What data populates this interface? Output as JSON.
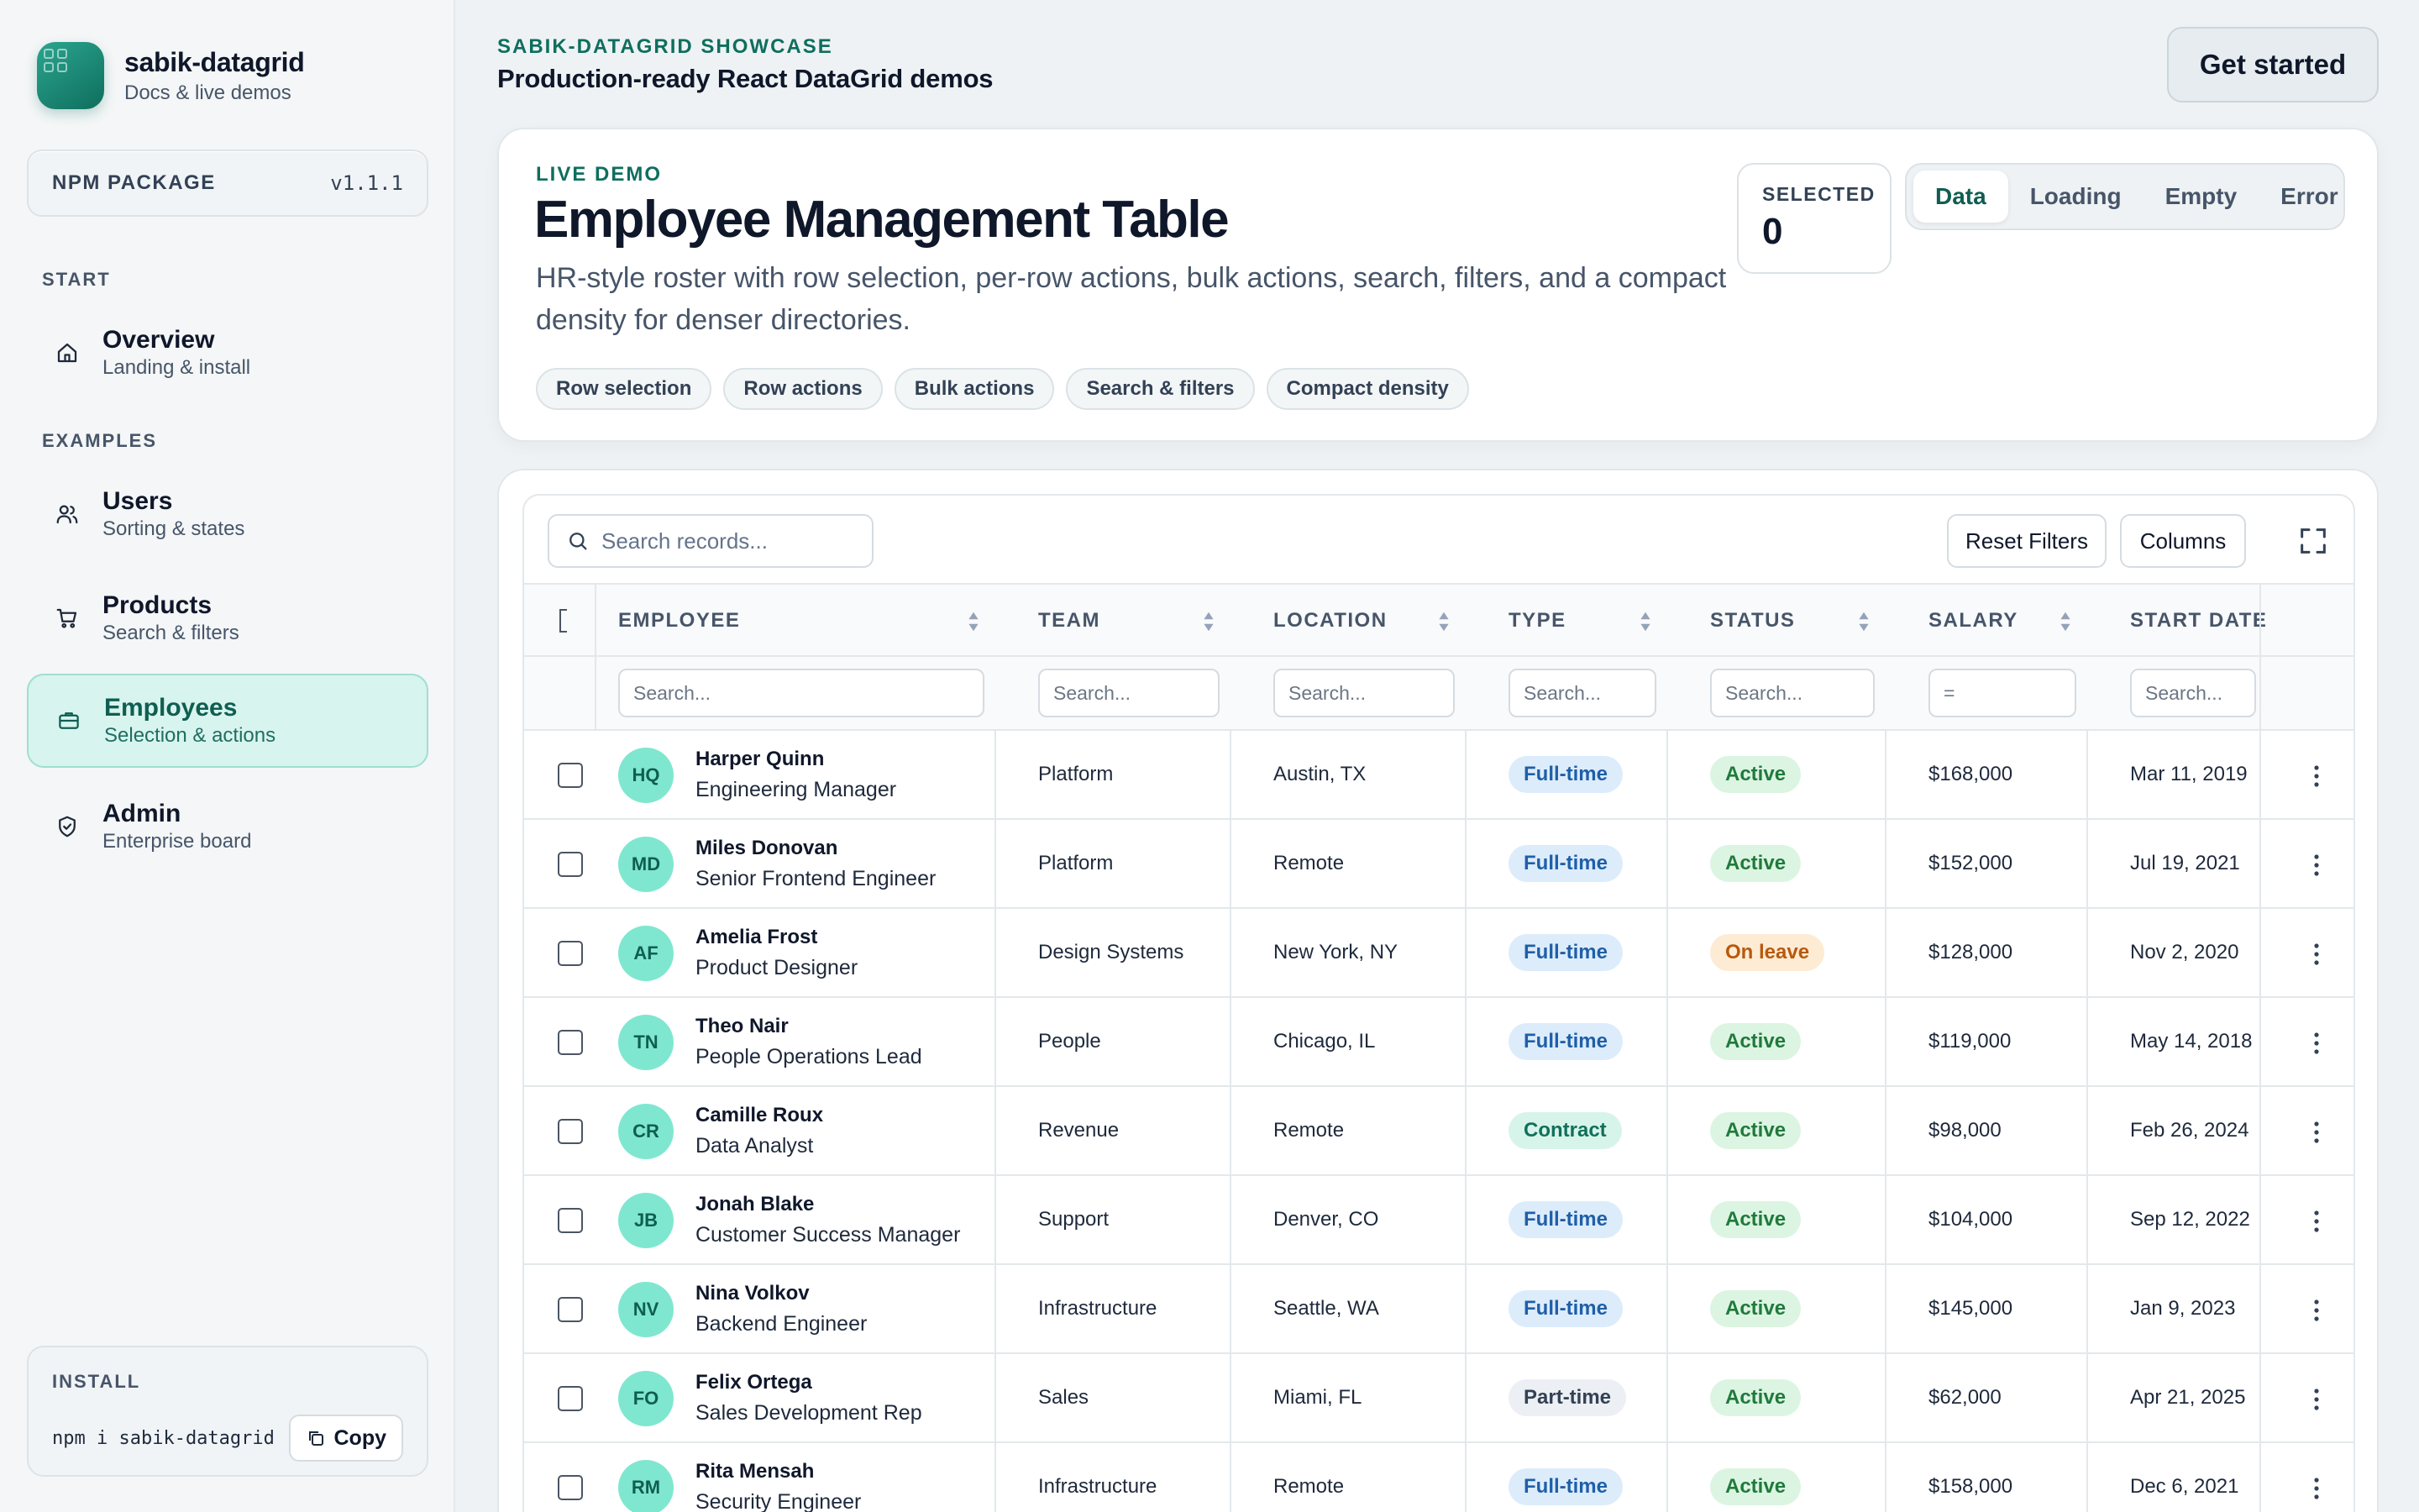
{
  "brand": {
    "name": "sabik-datagrid",
    "subtitle": "Docs & live demos"
  },
  "npm": {
    "label": "NPM PACKAGE",
    "version": "v1.1.1"
  },
  "sidebar": {
    "sections": [
      {
        "label": "START",
        "items": [
          {
            "title": "Overview",
            "subtitle": "Landing & install",
            "icon": "home-icon",
            "active": false
          }
        ]
      },
      {
        "label": "EXAMPLES",
        "items": [
          {
            "title": "Users",
            "subtitle": "Sorting & states",
            "icon": "users-icon",
            "active": false
          },
          {
            "title": "Products",
            "subtitle": "Search & filters",
            "icon": "cart-icon",
            "active": false
          },
          {
            "title": "Employees",
            "subtitle": "Selection & actions",
            "icon": "briefcase-icon",
            "active": true
          },
          {
            "title": "Admin",
            "subtitle": "Enterprise board",
            "icon": "shield-check-icon",
            "active": false
          }
        ]
      }
    ]
  },
  "install": {
    "label": "INSTALL",
    "command": "npm i sabik-datagrid",
    "copy_label": "Copy"
  },
  "header": {
    "eyebrow": "SABIK-DATAGRID SHOWCASE",
    "title": "Production-ready React DataGrid demos",
    "cta_label": "Get started"
  },
  "hero": {
    "eyebrow": "LIVE DEMO",
    "title": "Employee Management Table",
    "description": "HR-style roster with row selection, per-row actions, bulk actions, search, filters, and a compact density for denser directories.",
    "chips": [
      "Row selection",
      "Row actions",
      "Bulk actions",
      "Search & filters",
      "Compact density"
    ],
    "selected_label": "SELECTED",
    "selected_value": "0",
    "tabs": [
      {
        "label": "Data",
        "active": true
      },
      {
        "label": "Loading",
        "active": false
      },
      {
        "label": "Empty",
        "active": false
      },
      {
        "label": "Error",
        "active": false
      }
    ]
  },
  "grid": {
    "search_placeholder": "Search records...",
    "reset_label": "Reset Filters",
    "columns_label": "Columns",
    "columns": [
      {
        "key": "employee",
        "label": "EMPLOYEE",
        "filter_placeholder": "Search..."
      },
      {
        "key": "team",
        "label": "TEAM",
        "filter_placeholder": "Search..."
      },
      {
        "key": "location",
        "label": "LOCATION",
        "filter_placeholder": "Search..."
      },
      {
        "key": "type",
        "label": "TYPE",
        "filter_placeholder": "Search..."
      },
      {
        "key": "status",
        "label": "STATUS",
        "filter_placeholder": "Search..."
      },
      {
        "key": "salary",
        "label": "SALARY",
        "filter_placeholder": "="
      },
      {
        "key": "start_date",
        "label": "START DATE",
        "filter_placeholder": "Search..."
      }
    ],
    "rows": [
      {
        "initials": "HQ",
        "name": "Harper Quinn",
        "role": "Engineering Manager",
        "team": "Platform",
        "location": "Austin, TX",
        "type": "Full-time",
        "status": "Active",
        "salary": "$168,000",
        "start_date": "Mar 11, 2019"
      },
      {
        "initials": "MD",
        "name": "Miles Donovan",
        "role": "Senior Frontend Engineer",
        "team": "Platform",
        "location": "Remote",
        "type": "Full-time",
        "status": "Active",
        "salary": "$152,000",
        "start_date": "Jul 19, 2021"
      },
      {
        "initials": "AF",
        "name": "Amelia Frost",
        "role": "Product Designer",
        "team": "Design Systems",
        "location": "New York, NY",
        "type": "Full-time",
        "status": "On leave",
        "salary": "$128,000",
        "start_date": "Nov 2, 2020"
      },
      {
        "initials": "TN",
        "name": "Theo Nair",
        "role": "People Operations Lead",
        "team": "People",
        "location": "Chicago, IL",
        "type": "Full-time",
        "status": "Active",
        "salary": "$119,000",
        "start_date": "May 14, 2018"
      },
      {
        "initials": "CR",
        "name": "Camille Roux",
        "role": "Data Analyst",
        "team": "Revenue",
        "location": "Remote",
        "type": "Contract",
        "status": "Active",
        "salary": "$98,000",
        "start_date": "Feb 26, 2024"
      },
      {
        "initials": "JB",
        "name": "Jonah Blake",
        "role": "Customer Success Manager",
        "team": "Support",
        "location": "Denver, CO",
        "type": "Full-time",
        "status": "Active",
        "salary": "$104,000",
        "start_date": "Sep 12, 2022"
      },
      {
        "initials": "NV",
        "name": "Nina Volkov",
        "role": "Backend Engineer",
        "team": "Infrastructure",
        "location": "Seattle, WA",
        "type": "Full-time",
        "status": "Active",
        "salary": "$145,000",
        "start_date": "Jan 9, 2023"
      },
      {
        "initials": "FO",
        "name": "Felix Ortega",
        "role": "Sales Development Rep",
        "team": "Sales",
        "location": "Miami, FL",
        "type": "Part-time",
        "status": "Active",
        "salary": "$62,000",
        "start_date": "Apr 21, 2025"
      },
      {
        "initials": "RM",
        "name": "Rita Mensah",
        "role": "Security Engineer",
        "team": "Infrastructure",
        "location": "Remote",
        "type": "Full-time",
        "status": "Active",
        "salary": "$158,000",
        "start_date": "Dec 6, 2021"
      }
    ]
  },
  "colors": {
    "accent": "#0f6e5e",
    "accent_light": "#d8f4ee",
    "avatar_bg": "#7fe7d0"
  }
}
